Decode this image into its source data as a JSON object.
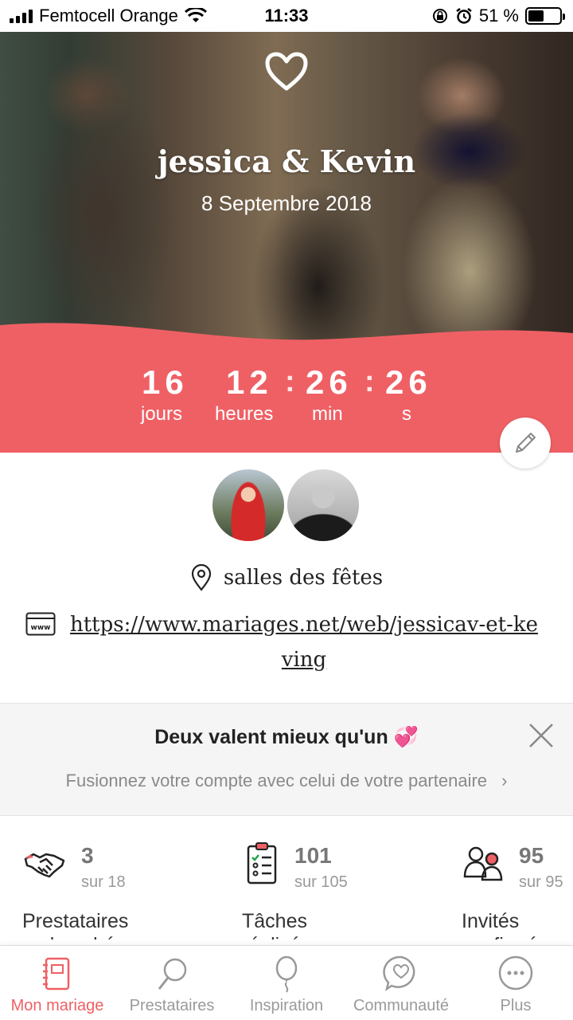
{
  "status_bar": {
    "carrier": "Femtocell Orange",
    "time": "11:33",
    "battery": "51 %",
    "battery_level": 0.51
  },
  "hero": {
    "couple_names": "jessica & Kevin",
    "date": "8 Septembre 2018",
    "icon": "heart-icon"
  },
  "countdown": {
    "days": "16",
    "hours": "12",
    "minutes": "26",
    "seconds": "26",
    "days_label": "jours",
    "hours_label": "heures",
    "minutes_label": "min",
    "seconds_label": "s",
    "accent_color": "#ef6065"
  },
  "details": {
    "location": "salles des fêtes",
    "website": "https://www.mariages.net/web/jessicav-et-keving"
  },
  "merge_banner": {
    "title": "Deux valent mieux qu'un 💞",
    "subtitle": "Fusionnez votre compte avec celui de votre partenaire"
  },
  "stats": [
    {
      "count": "3",
      "total": "sur 18",
      "label": "Prestataires",
      "label2": "embauchés",
      "icon": "handshake-icon"
    },
    {
      "count": "101",
      "total": "sur 105",
      "label": "Tâches",
      "label2": "réalisées",
      "icon": "checklist-icon"
    },
    {
      "count": "95",
      "total": "sur 95",
      "label": "Invités",
      "label2": "confirmés",
      "icon": "guests-icon"
    }
  ],
  "tabbar": [
    {
      "label": "Mon mariage",
      "icon": "notebook-icon",
      "active": true
    },
    {
      "label": "Prestataires",
      "icon": "magnifier-icon",
      "active": false
    },
    {
      "label": "Inspiration",
      "icon": "balloon-icon",
      "active": false
    },
    {
      "label": "Communauté",
      "icon": "chat-heart-icon",
      "active": false
    },
    {
      "label": "Plus",
      "icon": "more-icon",
      "active": false
    }
  ]
}
